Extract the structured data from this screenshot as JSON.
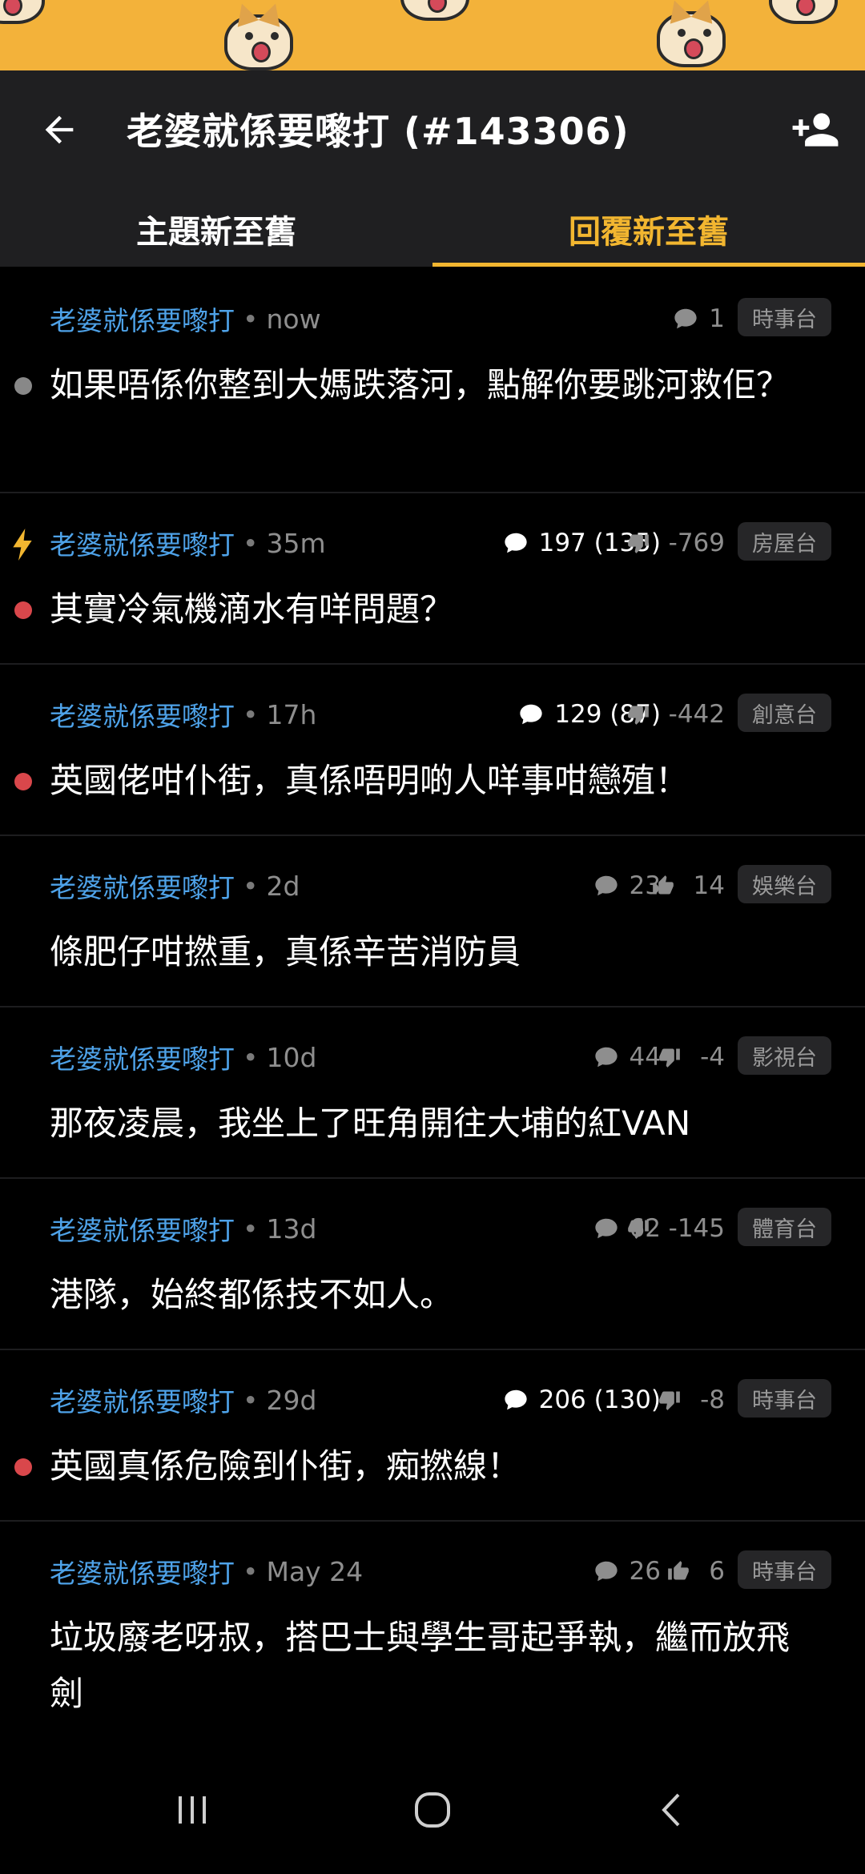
{
  "header": {
    "title": "老婆就係要嚟打 (#143306)"
  },
  "tabs": [
    {
      "label": "主題新至舊",
      "active": false
    },
    {
      "label": "回覆新至舊",
      "active": true
    }
  ],
  "colors": {
    "accent": "#f2b630",
    "author": "#4ea2e8",
    "hot_dot": "#d9474b",
    "normal_dot": "#888888"
  },
  "threads": [
    {
      "author": "老婆就係要嚟打",
      "time": "now",
      "replies": "1",
      "votes": "",
      "vote_type": "none",
      "channel": "時事台",
      "title": "如果唔係你整到大媽跌落河，點解你要跳河救佢？",
      "dot": "grey",
      "bolt": false,
      "hot": false
    },
    {
      "author": "老婆就係要嚟打",
      "time": "35m",
      "replies": "197 (135)",
      "votes": "-769",
      "vote_type": "down",
      "channel": "房屋台",
      "title": "其實冷氣機滴水有咩問題？",
      "dot": "red",
      "bolt": true,
      "hot": true
    },
    {
      "author": "老婆就係要嚟打",
      "time": "17h",
      "replies": "129 (87)",
      "votes": "-442",
      "vote_type": "down",
      "channel": "創意台",
      "title": "英國佬咁仆街，真係唔明啲人咩事咁戀殖！",
      "dot": "red",
      "bolt": false,
      "hot": true
    },
    {
      "author": "老婆就係要嚟打",
      "time": "2d",
      "replies": "23",
      "votes": "14",
      "vote_type": "up",
      "channel": "娛樂台",
      "title": "條肥仔咁撚重，真係辛苦消防員",
      "dot": "none",
      "bolt": false,
      "hot": false
    },
    {
      "author": "老婆就係要嚟打",
      "time": "10d",
      "replies": "44",
      "votes": "-4",
      "vote_type": "down",
      "channel": "影視台",
      "title": "那夜凌晨，我坐上了旺角開往大埔的紅VAN",
      "dot": "none",
      "bolt": false,
      "hot": false
    },
    {
      "author": "老婆就係要嚟打",
      "time": "13d",
      "replies": "62",
      "votes": "-145",
      "vote_type": "down",
      "channel": "體育台",
      "title": "港隊，始終都係技不如人。",
      "dot": "none",
      "bolt": false,
      "hot": false
    },
    {
      "author": "老婆就係要嚟打",
      "time": "29d",
      "replies": "206 (130)",
      "votes": "-8",
      "vote_type": "down",
      "channel": "時事台",
      "title": "英國真係危險到仆街，痴撚線！",
      "dot": "red",
      "bolt": false,
      "hot": true
    },
    {
      "author": "老婆就係要嚟打",
      "time": "May 24",
      "replies": "26",
      "votes": "6",
      "vote_type": "up",
      "channel": "時事台",
      "title": "垃圾廢老呀叔，搭巴士與學生哥起爭執，繼而放飛劍",
      "dot": "none",
      "bolt": false,
      "hot": false
    }
  ],
  "icons": {
    "back": "arrow-left-icon",
    "follow": "add-user-icon",
    "reply": "speech-bubble-icon",
    "upvote": "thumbs-up-icon",
    "downvote": "thumbs-down-icon",
    "bolt": "lightning-bolt-icon"
  }
}
